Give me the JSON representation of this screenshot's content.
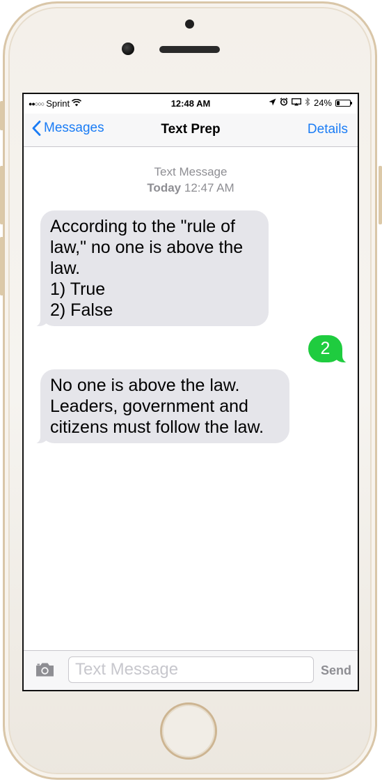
{
  "status_bar": {
    "signal": "●●○○○",
    "carrier": "Sprint",
    "time": "12:48 AM",
    "battery_percent": "24%",
    "battery_level": 0.24
  },
  "nav": {
    "back_label": "Messages",
    "title": "Text Prep",
    "details_label": "Details"
  },
  "thread": {
    "header_type": "Text Message",
    "header_day": "Today",
    "header_time": "12:47 AM",
    "messages": [
      {
        "direction": "incoming",
        "text": "According to the \"rule of\nlaw,\" no one is above the\nlaw.\n1) True\n2) False"
      },
      {
        "direction": "outgoing",
        "text": "2"
      },
      {
        "direction": "incoming",
        "text": "No one is above the law.\nLeaders, government and\ncitizens must follow the law."
      }
    ]
  },
  "composer": {
    "placeholder": "Text Message",
    "send_label": "Send"
  },
  "colors": {
    "accent_blue": "#1a7cf5",
    "outgoing_green": "#1fcc3f",
    "incoming_gray": "#e5e5ea"
  }
}
